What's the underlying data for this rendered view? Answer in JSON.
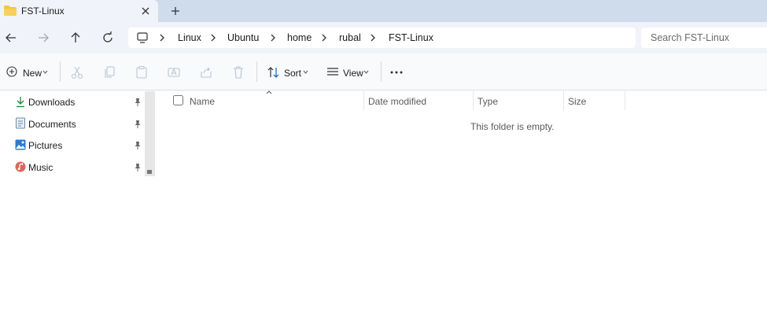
{
  "tab": {
    "title": "FST-Linux"
  },
  "breadcrumbs": [
    "Linux",
    "Ubuntu",
    "home",
    "rubal",
    "FST-Linux"
  ],
  "search": {
    "placeholder": "Search FST-Linux"
  },
  "commands": {
    "new_label": "New",
    "sort_label": "Sort",
    "view_label": "View"
  },
  "sidebar": {
    "items": [
      {
        "label": "Downloads",
        "icon": "download-icon"
      },
      {
        "label": "Documents",
        "icon": "documents-icon"
      },
      {
        "label": "Pictures",
        "icon": "pictures-icon"
      },
      {
        "label": "Music",
        "icon": "music-icon"
      }
    ]
  },
  "columns": {
    "name": "Name",
    "date_modified": "Date modified",
    "type": "Type",
    "size": "Size"
  },
  "content": {
    "empty_message": "This folder is empty."
  },
  "colors": {
    "accent": "#0067c0",
    "folder": "#f5c542",
    "tabstrip": "#cfdcec"
  }
}
